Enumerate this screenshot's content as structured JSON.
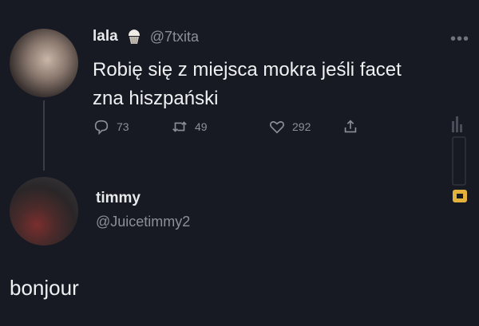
{
  "tweet": {
    "author_name": "lala",
    "author_handle": "@7txita",
    "text_line1": "Robię się z miejsca mokra jeśli facet",
    "text_line2": "zna hiszpański",
    "reply_count": "73",
    "retweet_count": "49",
    "like_count": "292",
    "name_emoji_icon": "cupcake-icon"
  },
  "reply": {
    "author_name": "timmy",
    "author_handle": "@Juicetimmy2",
    "text": "bonjour"
  },
  "colors": {
    "background": "#181a23",
    "muted": "#8b8f98",
    "text": "#e7e9ea"
  }
}
